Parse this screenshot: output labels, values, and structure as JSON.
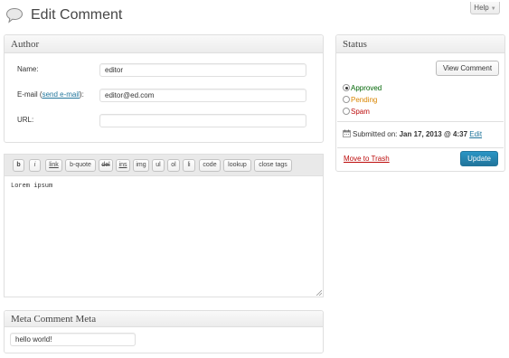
{
  "header": {
    "title": "Edit Comment",
    "help_label": "Help"
  },
  "author_box": {
    "title": "Author",
    "name_label": "Name:",
    "name_value": "editor",
    "email_label_prefix": "E-mail (",
    "email_link": "send e-mail",
    "email_label_suffix": "):",
    "email_value": "editor@ed.com",
    "url_label": "URL:",
    "url_value": ""
  },
  "editor": {
    "buttons": [
      "b",
      "i",
      "link",
      "b-quote",
      "del",
      "ins",
      "img",
      "ul",
      "ol",
      "li",
      "code",
      "lookup",
      "close tags"
    ],
    "content": "Lorem ipsum"
  },
  "meta_box": {
    "title": "Meta Comment Meta",
    "value": "hello world!"
  },
  "status_box": {
    "title": "Status",
    "view_button": "View Comment",
    "options": [
      {
        "label": "Approved",
        "color": "#006505",
        "checked": true
      },
      {
        "label": "Pending",
        "color": "#d98500",
        "checked": false
      },
      {
        "label": "Spam",
        "color": "#bc0b0b",
        "checked": false
      }
    ],
    "submitted_prefix": "Submitted on:",
    "submitted_date": "Jan 17, 2013 @ 4:37",
    "edit_link": "Edit",
    "trash_link": "Move to Trash",
    "update_button": "Update"
  },
  "colors": {
    "link": "#21759b",
    "approved": "#006505",
    "pending": "#d98500",
    "spam": "#bc0b0b",
    "primary_button": "#21759b"
  },
  "icons": {
    "page_icon": "comment-bubble-icon",
    "calendar": "calendar-icon"
  }
}
